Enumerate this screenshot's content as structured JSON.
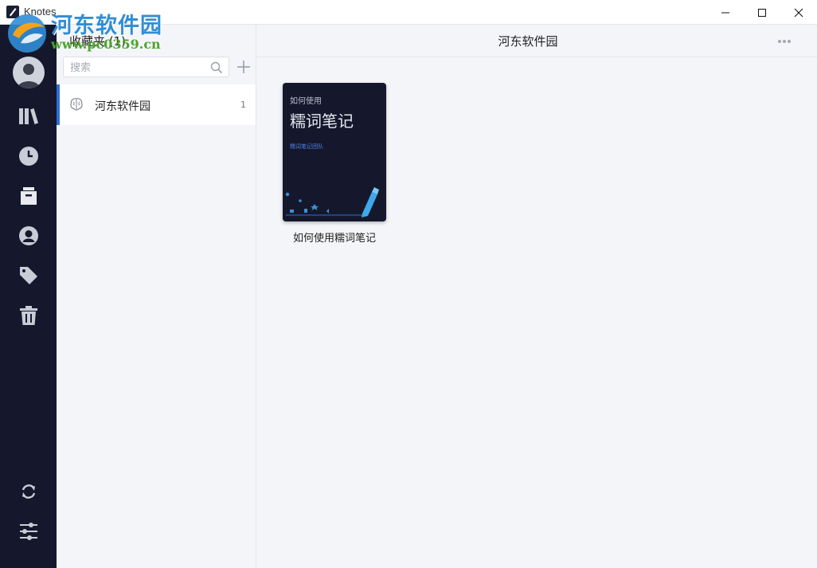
{
  "window": {
    "title": "Knotes"
  },
  "watermark": {
    "title": "河东软件园",
    "url": "www.pc0359.cn"
  },
  "sidebar": {
    "items": [
      {
        "name": "library",
        "icon": "library-icon"
      },
      {
        "name": "recent",
        "icon": "clock-icon"
      },
      {
        "name": "favorites",
        "icon": "archive-box-icon"
      },
      {
        "name": "contacts",
        "icon": "user-circle-icon"
      },
      {
        "name": "tags",
        "icon": "tag-icon"
      },
      {
        "name": "trash",
        "icon": "trash-icon"
      }
    ],
    "bottom": [
      {
        "name": "sync",
        "icon": "sync-icon"
      },
      {
        "name": "settings",
        "icon": "sliders-icon"
      }
    ]
  },
  "list": {
    "heading": "收藏夹 (1)",
    "search_placeholder": "搜索",
    "items": [
      {
        "label": "河东软件园",
        "count": "1",
        "icon": "brain-icon"
      }
    ]
  },
  "main": {
    "title": "河东软件园",
    "notes": [
      {
        "cover_subtitle": "如何使用",
        "cover_title": "糯词笔记",
        "cover_team": "糯词笔记团队",
        "title": "如何使用糯词笔记"
      }
    ]
  },
  "colors": {
    "rail": "#15182c",
    "accent": "#2f6fd6",
    "panel": "#f4f5f9"
  }
}
